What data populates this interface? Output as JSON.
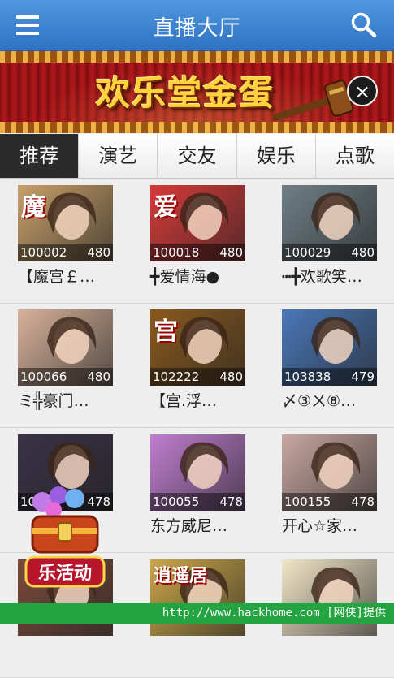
{
  "header": {
    "title": "直播大厅",
    "menu_icon": "menu-icon",
    "search_icon": "search-icon"
  },
  "banner": {
    "text": "欢乐堂金蛋",
    "close_label": "×"
  },
  "tabs": [
    {
      "label": "推荐",
      "active": true
    },
    {
      "label": "演艺",
      "active": false
    },
    {
      "label": "交友",
      "active": false
    },
    {
      "label": "娱乐",
      "active": false
    },
    {
      "label": "点歌",
      "active": false
    }
  ],
  "rooms": [
    {
      "id": "100002",
      "count": "480",
      "name": "【魔宫￡…",
      "badge": "魔",
      "color": "#c8a06a"
    },
    {
      "id": "100018",
      "count": "480",
      "name": "╋爱情海●",
      "badge": "爱",
      "color": "#d83a3a"
    },
    {
      "id": "100029",
      "count": "480",
      "name": "┅╋欢歌笑…",
      "badge": "",
      "color": "#6f7f86"
    },
    {
      "id": "100066",
      "count": "480",
      "name": "ミ╬豪门…",
      "badge": "",
      "color": "#d8b29b"
    },
    {
      "id": "102222",
      "count": "480",
      "name": "【宫.浮…",
      "badge": "宫",
      "color": "#8a5a1e"
    },
    {
      "id": "103838",
      "count": "479",
      "name": "〆③ㄨ⑧…",
      "badge": "",
      "color": "#4a78b8"
    },
    {
      "id": "100?",
      "count": "478",
      "name": "",
      "badge": "",
      "color": "#3a3246"
    },
    {
      "id": "100055",
      "count": "478",
      "name": "东方威尼…",
      "badge": "",
      "color": "#c07fd0"
    },
    {
      "id": "100155",
      "count": "478",
      "name": "开心☆家…",
      "badge": "",
      "color": "#c9a7a2"
    },
    {
      "id": "",
      "count": "",
      "name": "",
      "badge": "",
      "color": "#7a4a3a"
    },
    {
      "id": "",
      "count": "",
      "name": "",
      "badge": "逍遥居",
      "color": "#caa64a"
    },
    {
      "id": "",
      "count": "",
      "name": "",
      "badge": "",
      "color": "#f2e6c8"
    }
  ],
  "row3_first_id_visible": "10",
  "float_button": {
    "label": "乐活动"
  },
  "footer": {
    "text": "http://www.hackhome.com [网侠]提供"
  }
}
